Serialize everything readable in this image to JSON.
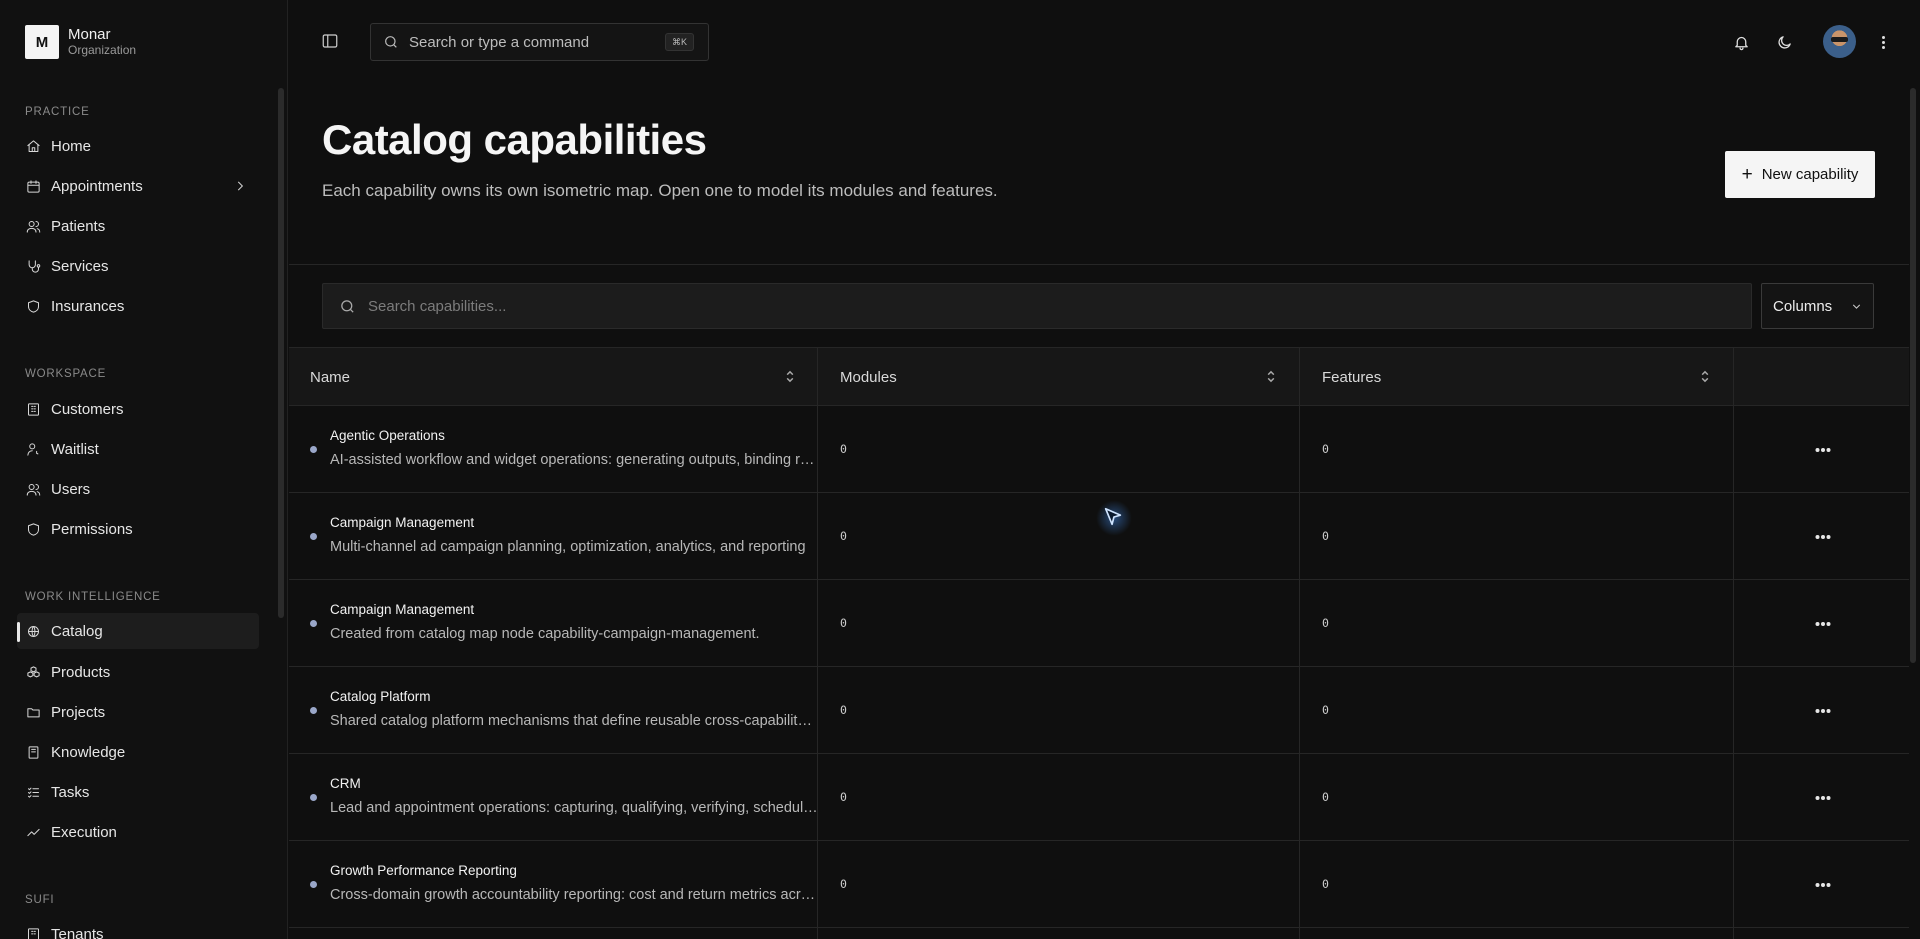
{
  "org": {
    "logo_letter": "M",
    "name": "Monar",
    "subtitle": "Organization"
  },
  "sidebar": {
    "sections": [
      {
        "label": "PRACTICE",
        "items": [
          {
            "label": "Home",
            "icon": "home-icon"
          },
          {
            "label": "Appointments",
            "icon": "calendar-icon",
            "has_submenu": true
          },
          {
            "label": "Patients",
            "icon": "users-icon"
          },
          {
            "label": "Services",
            "icon": "stethoscope-icon"
          },
          {
            "label": "Insurances",
            "icon": "shield-icon"
          }
        ]
      },
      {
        "label": "WORKSPACE",
        "items": [
          {
            "label": "Customers",
            "icon": "building-icon"
          },
          {
            "label": "Waitlist",
            "icon": "user-clock-icon"
          },
          {
            "label": "Users",
            "icon": "users-icon"
          },
          {
            "label": "Permissions",
            "icon": "shield-icon"
          }
        ]
      },
      {
        "label": "WORK INTELLIGENCE",
        "items": [
          {
            "label": "Catalog",
            "icon": "globe-icon",
            "active": true
          },
          {
            "label": "Products",
            "icon": "boxes-icon"
          },
          {
            "label": "Projects",
            "icon": "folder-icon"
          },
          {
            "label": "Knowledge",
            "icon": "book-icon"
          },
          {
            "label": "Tasks",
            "icon": "list-icon"
          },
          {
            "label": "Execution",
            "icon": "trend-icon"
          }
        ]
      },
      {
        "label": "SUFI",
        "items": [
          {
            "label": "Tenants",
            "icon": "building-icon"
          }
        ]
      }
    ]
  },
  "topbar": {
    "search_placeholder": "Search or type a command",
    "shortcut": "⌘K",
    "icons": [
      "panel-toggle-icon",
      "bell-icon",
      "moon-icon",
      "avatar",
      "more-vertical-icon"
    ]
  },
  "page": {
    "title": "Catalog capabilities",
    "subtitle": "Each capability owns its own isometric map. Open one to model its modules and features.",
    "new_button": "New capability",
    "search_placeholder": "Search capabilities...",
    "columns_button": "Columns"
  },
  "table": {
    "headers": [
      "Name",
      "Modules",
      "Features"
    ],
    "rows": [
      {
        "name": "Agentic Operations",
        "description": "AI-assisted workflow and widget operations: generating outputs, binding results and orchestrating agents",
        "modules": "0",
        "features": "0"
      },
      {
        "name": "Campaign Management",
        "description": "Multi-channel ad campaign planning, optimization, analytics, and reporting",
        "modules": "0",
        "features": "0"
      },
      {
        "name": "Campaign Management",
        "description": "Created from catalog map node capability-campaign-management.",
        "modules": "0",
        "features": "0"
      },
      {
        "name": "Catalog Platform",
        "description": "Shared catalog platform mechanisms that define reusable cross-capability building blocks",
        "modules": "0",
        "features": "0"
      },
      {
        "name": "CRM",
        "description": "Lead and appointment operations: capturing, qualifying, verifying, scheduling and following up",
        "modules": "0",
        "features": "0"
      },
      {
        "name": "Growth Performance Reporting",
        "description": "Cross-domain growth accountability reporting: cost and return metrics across channels",
        "modules": "0",
        "features": "0"
      }
    ]
  },
  "colors": {
    "background": "#0f0f0f",
    "accent": "#f5f5f5",
    "status_dot": "#9aa7c9"
  }
}
